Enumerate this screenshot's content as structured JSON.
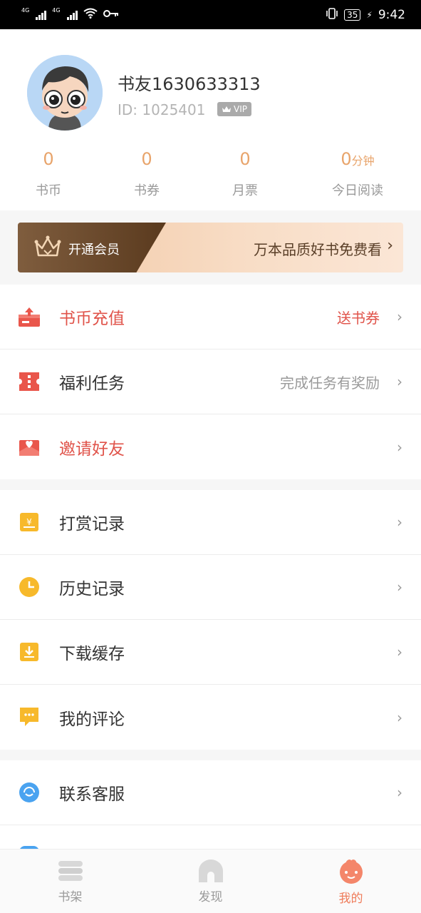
{
  "status_bar": {
    "network1": "4G",
    "network2": "4G",
    "battery": "35",
    "time": "9:42"
  },
  "profile": {
    "username": "书友1630633313",
    "user_id": "ID: 1025401",
    "vip_badge": "VIP"
  },
  "stats": [
    {
      "value": "0",
      "unit": "",
      "label": "书币"
    },
    {
      "value": "0",
      "unit": "",
      "label": "书券"
    },
    {
      "value": "0",
      "unit": "",
      "label": "月票"
    },
    {
      "value": "0",
      "unit": "分钟",
      "label": "今日阅读"
    }
  ],
  "vip_banner": {
    "open_label": "开通会员",
    "promo": "万本品质好书免费看"
  },
  "menu_group1": [
    {
      "label": "书币充值",
      "extra": "送书券",
      "icon": "coin-recharge-icon"
    },
    {
      "label": "福利任务",
      "extra": "完成任务有奖励",
      "icon": "ticket-icon"
    },
    {
      "label": "邀请好友",
      "extra": "",
      "icon": "envelope-heart-icon"
    }
  ],
  "menu_group2": [
    {
      "label": "打赏记录",
      "icon": "reward-icon"
    },
    {
      "label": "历史记录",
      "icon": "clock-icon"
    },
    {
      "label": "下载缓存",
      "icon": "download-icon"
    },
    {
      "label": "我的评论",
      "icon": "comment-icon"
    }
  ],
  "menu_group3": [
    {
      "label": "联系客服",
      "icon": "support-icon"
    }
  ],
  "bottom_nav": [
    {
      "label": "书架",
      "icon": "bookshelf-icon",
      "active": false
    },
    {
      "label": "发现",
      "icon": "discover-icon",
      "active": false
    },
    {
      "label": "我的",
      "icon": "mine-icon",
      "active": true
    }
  ],
  "colors": {
    "accent_orange": "#e8a46b",
    "red": "#e0534a",
    "yellow": "#f7b92b",
    "active_nav": "#ef7c5b"
  }
}
